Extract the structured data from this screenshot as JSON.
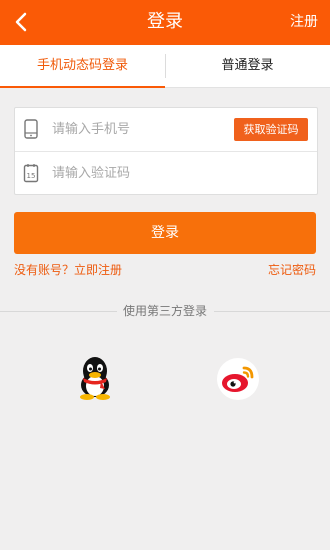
{
  "header": {
    "title": "登录",
    "register": "注册"
  },
  "tabs": {
    "active": "手机动态码登录",
    "normal": "普通登录"
  },
  "form": {
    "phone_placeholder": "请输入手机号",
    "code_placeholder": "请输入验证码",
    "get_code": "获取验证码"
  },
  "login_button": "登录",
  "links": {
    "no_account": "没有账号？立即注册",
    "forgot": "忘记密码"
  },
  "third_party": {
    "label": "使用第三方登录",
    "icons": [
      "qq-icon",
      "weibo-icon"
    ]
  },
  "colors": {
    "primary": "#fa5a06",
    "button": "#f7700b",
    "link": "#ee5b0e"
  }
}
